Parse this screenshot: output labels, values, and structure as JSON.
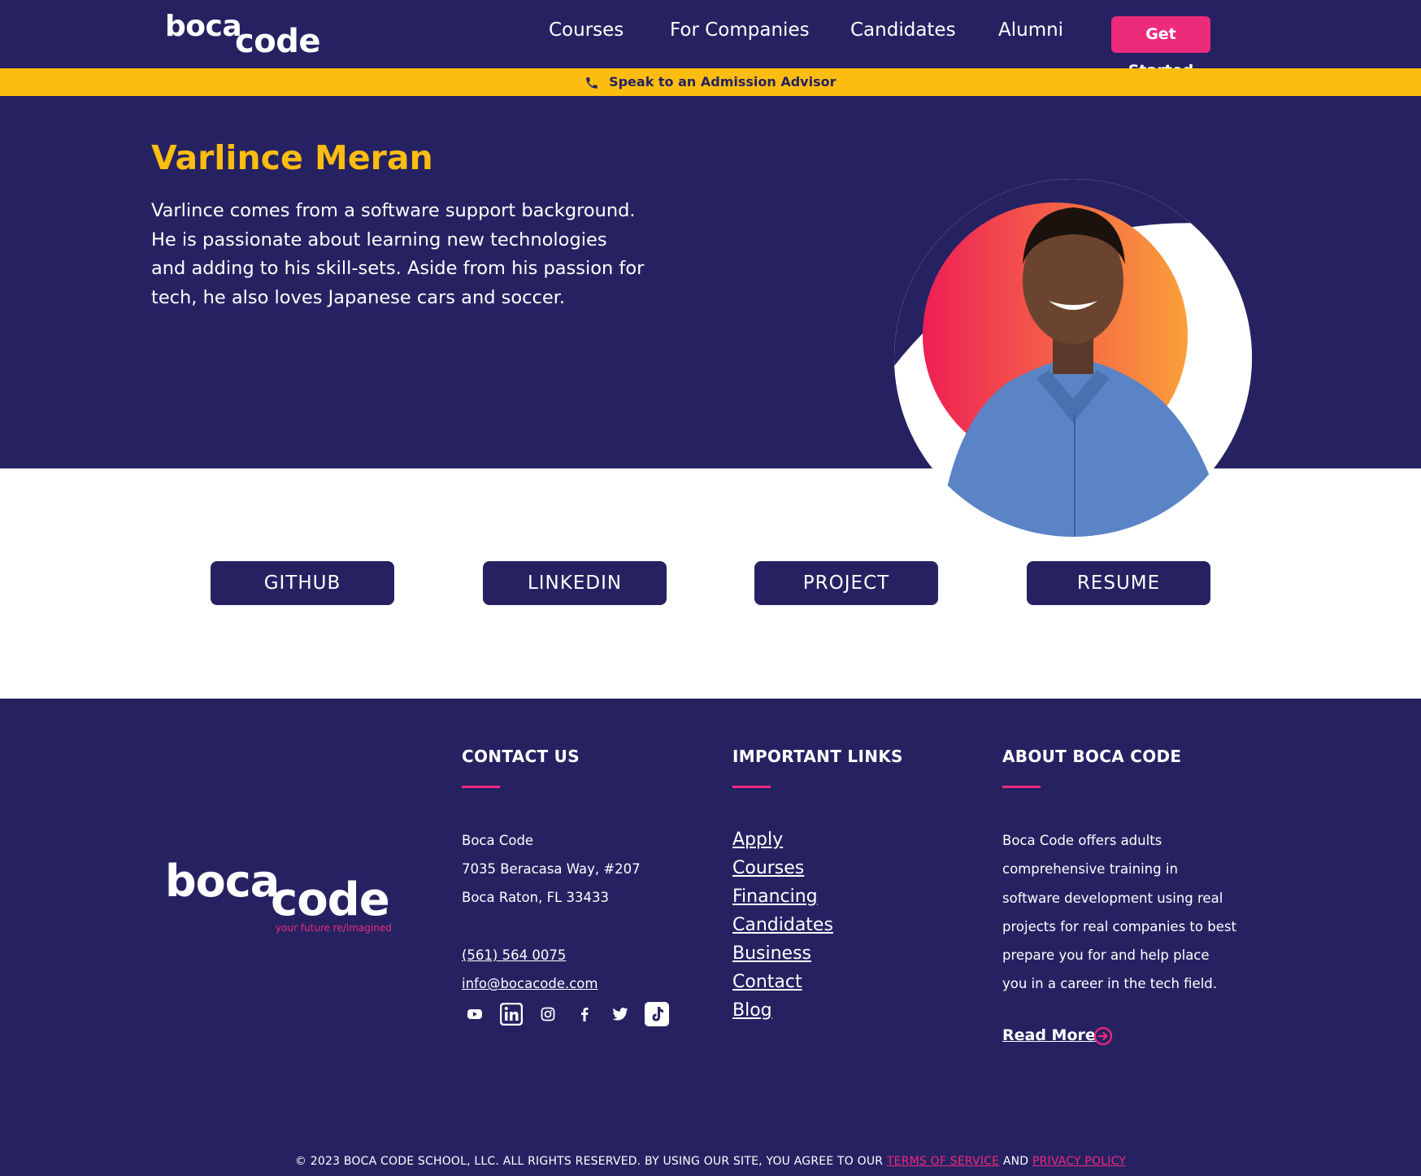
{
  "header": {
    "logo": {
      "part1": "boca",
      "part2": "code"
    },
    "nav": [
      "Courses",
      "For Companies",
      "Candidates",
      "Alumni"
    ],
    "cta": "Get Started"
  },
  "banner": {
    "text": "Speak to an Admission Advisor",
    "icon": "phone-icon"
  },
  "profile": {
    "name": "Varlince Meran",
    "bio": "Varlince comes from a software support background. He is passionate about learning new technologies and adding to his skill-sets. Aside from his passion for tech, he also loves Japanese cars and soccer."
  },
  "buttons": [
    "GITHUB",
    "LINKEDIN",
    "PROJECT",
    "RESUME"
  ],
  "footer": {
    "logo": {
      "part1": "boca",
      "part2": "code",
      "tagline": "your future re/imagined"
    },
    "contact": {
      "heading": "CONTACT US",
      "name": "Boca Code",
      "address1": "7035 Beracasa Way, #207",
      "address2": "Boca Raton, FL 33433",
      "phone": "(561) 564 0075",
      "email": "info@bocacode.com",
      "social": [
        "youtube-icon",
        "linkedin-icon",
        "instagram-icon",
        "facebook-icon",
        "twitter-icon",
        "tiktok-icon"
      ]
    },
    "links": {
      "heading": "IMPORTANT LINKS",
      "items": [
        "Apply",
        "Courses",
        "Financing",
        "Candidates",
        "Business",
        "Contact",
        "Blog"
      ]
    },
    "about": {
      "heading": "ABOUT BOCA CODE",
      "text": "Boca Code offers adults comprehensive training in software development using real projects for real companies to best prepare you for and help place you in a career in the tech field.",
      "read_more": "Read More"
    },
    "copyright": {
      "text": "© 2023 BOCA CODE SCHOOL, LLC. ALL RIGHTS RESERVED. BY USING OUR SITE, YOU AGREE TO OUR",
      "terms": "TERMS OF SERVICE",
      "and": "AND",
      "privacy": "PRIVACY POLICY"
    }
  },
  "colors": {
    "navy": "#262262",
    "yellow": "#fdbd10",
    "pink": "#ee2a7b"
  }
}
